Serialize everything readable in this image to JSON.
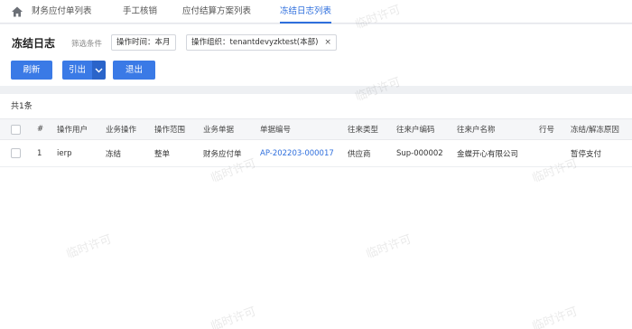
{
  "tabs": [
    {
      "label": "财务应付单列表",
      "active": false
    },
    {
      "label": "手工核销",
      "active": false
    },
    {
      "label": "应付结算方案列表",
      "active": false
    },
    {
      "label": "冻结日志列表",
      "active": true
    }
  ],
  "page": {
    "title": "冻结日志",
    "filter_label": "筛选条件",
    "filters": [
      "操作时间：本月",
      "操作组织：tenantdevyzktest(本部)"
    ],
    "filter_close": "×"
  },
  "toolbar": {
    "refresh": "刷新",
    "export": "引出",
    "exit": "退出"
  },
  "table": {
    "count_text": "共1条",
    "columns": [
      "#",
      "操作用户",
      "业务操作",
      "操作范围",
      "业务单据",
      "单据编号",
      "往来类型",
      "往来户编码",
      "往来户名称",
      "行号",
      "冻结/解冻原因"
    ],
    "rows": [
      [
        "1",
        "ierp",
        "冻结",
        "整单",
        "财务应付单",
        "AP-202203-000017",
        "供应商",
        "Sup-000002",
        "金蝶开心有限公司",
        "",
        "暂停支付"
      ]
    ]
  },
  "watermark": "临时许可",
  "colors": {
    "accent": "#3a7ae6",
    "link": "#2f6fdd"
  }
}
